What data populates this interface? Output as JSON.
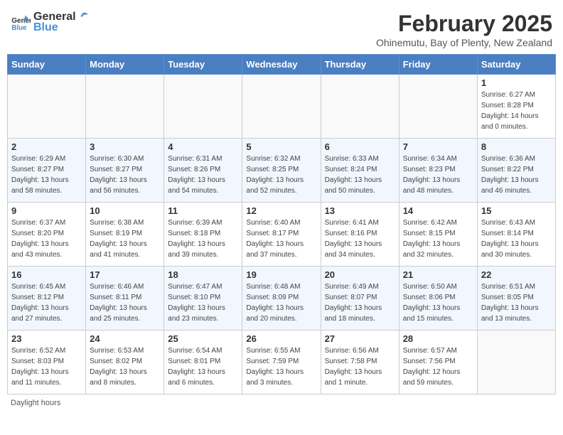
{
  "header": {
    "logo_general": "General",
    "logo_blue": "Blue",
    "month_title": "February 2025",
    "subtitle": "Ohinemutu, Bay of Plenty, New Zealand"
  },
  "weekdays": [
    "Sunday",
    "Monday",
    "Tuesday",
    "Wednesday",
    "Thursday",
    "Friday",
    "Saturday"
  ],
  "footer": "Daylight hours",
  "weeks": [
    [
      {
        "day": "",
        "info": ""
      },
      {
        "day": "",
        "info": ""
      },
      {
        "day": "",
        "info": ""
      },
      {
        "day": "",
        "info": ""
      },
      {
        "day": "",
        "info": ""
      },
      {
        "day": "",
        "info": ""
      },
      {
        "day": "1",
        "info": "Sunrise: 6:27 AM\nSunset: 8:28 PM\nDaylight: 14 hours\nand 0 minutes."
      }
    ],
    [
      {
        "day": "2",
        "info": "Sunrise: 6:29 AM\nSunset: 8:27 PM\nDaylight: 13 hours\nand 58 minutes."
      },
      {
        "day": "3",
        "info": "Sunrise: 6:30 AM\nSunset: 8:27 PM\nDaylight: 13 hours\nand 56 minutes."
      },
      {
        "day": "4",
        "info": "Sunrise: 6:31 AM\nSunset: 8:26 PM\nDaylight: 13 hours\nand 54 minutes."
      },
      {
        "day": "5",
        "info": "Sunrise: 6:32 AM\nSunset: 8:25 PM\nDaylight: 13 hours\nand 52 minutes."
      },
      {
        "day": "6",
        "info": "Sunrise: 6:33 AM\nSunset: 8:24 PM\nDaylight: 13 hours\nand 50 minutes."
      },
      {
        "day": "7",
        "info": "Sunrise: 6:34 AM\nSunset: 8:23 PM\nDaylight: 13 hours\nand 48 minutes."
      },
      {
        "day": "8",
        "info": "Sunrise: 6:36 AM\nSunset: 8:22 PM\nDaylight: 13 hours\nand 46 minutes."
      }
    ],
    [
      {
        "day": "9",
        "info": "Sunrise: 6:37 AM\nSunset: 8:20 PM\nDaylight: 13 hours\nand 43 minutes."
      },
      {
        "day": "10",
        "info": "Sunrise: 6:38 AM\nSunset: 8:19 PM\nDaylight: 13 hours\nand 41 minutes."
      },
      {
        "day": "11",
        "info": "Sunrise: 6:39 AM\nSunset: 8:18 PM\nDaylight: 13 hours\nand 39 minutes."
      },
      {
        "day": "12",
        "info": "Sunrise: 6:40 AM\nSunset: 8:17 PM\nDaylight: 13 hours\nand 37 minutes."
      },
      {
        "day": "13",
        "info": "Sunrise: 6:41 AM\nSunset: 8:16 PM\nDaylight: 13 hours\nand 34 minutes."
      },
      {
        "day": "14",
        "info": "Sunrise: 6:42 AM\nSunset: 8:15 PM\nDaylight: 13 hours\nand 32 minutes."
      },
      {
        "day": "15",
        "info": "Sunrise: 6:43 AM\nSunset: 8:14 PM\nDaylight: 13 hours\nand 30 minutes."
      }
    ],
    [
      {
        "day": "16",
        "info": "Sunrise: 6:45 AM\nSunset: 8:12 PM\nDaylight: 13 hours\nand 27 minutes."
      },
      {
        "day": "17",
        "info": "Sunrise: 6:46 AM\nSunset: 8:11 PM\nDaylight: 13 hours\nand 25 minutes."
      },
      {
        "day": "18",
        "info": "Sunrise: 6:47 AM\nSunset: 8:10 PM\nDaylight: 13 hours\nand 23 minutes."
      },
      {
        "day": "19",
        "info": "Sunrise: 6:48 AM\nSunset: 8:09 PM\nDaylight: 13 hours\nand 20 minutes."
      },
      {
        "day": "20",
        "info": "Sunrise: 6:49 AM\nSunset: 8:07 PM\nDaylight: 13 hours\nand 18 minutes."
      },
      {
        "day": "21",
        "info": "Sunrise: 6:50 AM\nSunset: 8:06 PM\nDaylight: 13 hours\nand 15 minutes."
      },
      {
        "day": "22",
        "info": "Sunrise: 6:51 AM\nSunset: 8:05 PM\nDaylight: 13 hours\nand 13 minutes."
      }
    ],
    [
      {
        "day": "23",
        "info": "Sunrise: 6:52 AM\nSunset: 8:03 PM\nDaylight: 13 hours\nand 11 minutes."
      },
      {
        "day": "24",
        "info": "Sunrise: 6:53 AM\nSunset: 8:02 PM\nDaylight: 13 hours\nand 8 minutes."
      },
      {
        "day": "25",
        "info": "Sunrise: 6:54 AM\nSunset: 8:01 PM\nDaylight: 13 hours\nand 6 minutes."
      },
      {
        "day": "26",
        "info": "Sunrise: 6:55 AM\nSunset: 7:59 PM\nDaylight: 13 hours\nand 3 minutes."
      },
      {
        "day": "27",
        "info": "Sunrise: 6:56 AM\nSunset: 7:58 PM\nDaylight: 13 hours\nand 1 minute."
      },
      {
        "day": "28",
        "info": "Sunrise: 6:57 AM\nSunset: 7:56 PM\nDaylight: 12 hours\nand 59 minutes."
      },
      {
        "day": "",
        "info": ""
      }
    ]
  ]
}
